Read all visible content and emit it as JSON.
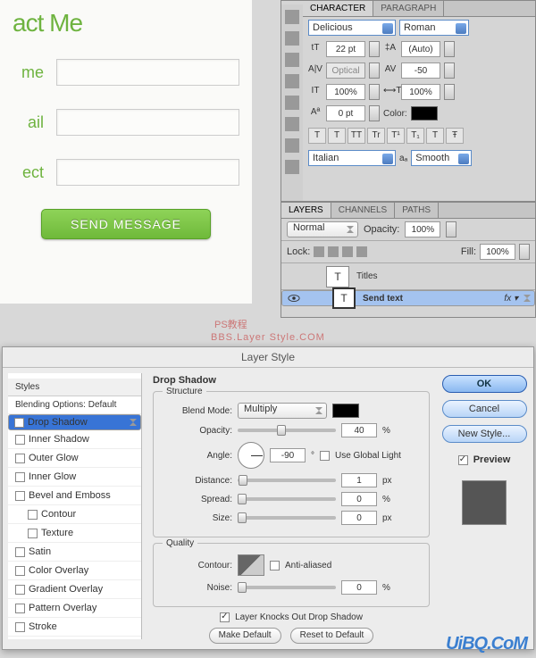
{
  "form": {
    "title": "act Me",
    "labels": {
      "name": "me",
      "email": "ail",
      "subject": "ect"
    },
    "button": "SEND MESSAGE"
  },
  "char_panel": {
    "tabs": [
      "CHARACTER",
      "PARAGRAPH"
    ],
    "font_family": "Delicious",
    "font_style": "Roman",
    "font_size": "22 pt",
    "leading": "(Auto)",
    "kerning": "Optical",
    "tracking": "-50",
    "scale_v": "100%",
    "scale_h": "100%",
    "baseline": "0 pt",
    "color_label": "Color:",
    "fmt": [
      "T",
      "T",
      "TT",
      "Tr",
      "T¹",
      "T₁",
      "T",
      "Ŧ"
    ],
    "language": "Italian",
    "aa_label": "aₐ",
    "aa_value": "Smooth"
  },
  "layers_panel": {
    "tabs": [
      "LAYERS",
      "CHANNELS",
      "PATHS"
    ],
    "blend": "Normal",
    "opacity_label": "Opacity:",
    "opacity": "100%",
    "lock_label": "Lock:",
    "fill_label": "Fill:",
    "fill": "100%",
    "layers": [
      {
        "name": "Titles",
        "sel": false
      },
      {
        "name": "Send text",
        "sel": true
      }
    ]
  },
  "watermark": {
    "l1": "PS教程",
    "l2": "BBS.Layer Style.COM"
  },
  "layer_style": {
    "title": "Layer Style",
    "side_header": "Styles",
    "blend_defaults": "Blending Options: Default",
    "effects": [
      {
        "name": "Drop Shadow",
        "checked": true,
        "sel": true
      },
      {
        "name": "Inner Shadow",
        "checked": false
      },
      {
        "name": "Outer Glow",
        "checked": false
      },
      {
        "name": "Inner Glow",
        "checked": false
      },
      {
        "name": "Bevel and Emboss",
        "checked": false
      },
      {
        "name": "Contour",
        "checked": false,
        "sub": true
      },
      {
        "name": "Texture",
        "checked": false,
        "sub": true
      },
      {
        "name": "Satin",
        "checked": false
      },
      {
        "name": "Color Overlay",
        "checked": false
      },
      {
        "name": "Gradient Overlay",
        "checked": false
      },
      {
        "name": "Pattern Overlay",
        "checked": false
      },
      {
        "name": "Stroke",
        "checked": false
      }
    ],
    "section": "Drop Shadow",
    "structure": "Structure",
    "blend_mode_label": "Blend Mode:",
    "blend_mode": "Multiply",
    "opacity_label": "Opacity:",
    "opacity": "40",
    "angle_label": "Angle:",
    "angle": "-90",
    "global_light": "Use Global Light",
    "distance_label": "Distance:",
    "distance": "1",
    "spread_label": "Spread:",
    "spread": "0",
    "size_label": "Size:",
    "size": "0",
    "px": "px",
    "deg": "°",
    "pct": "%",
    "quality": "Quality",
    "contour_label": "Contour:",
    "aa": "Anti-aliased",
    "noise_label": "Noise:",
    "noise": "0",
    "knockout": "Layer Knocks Out Drop Shadow",
    "make_default": "Make Default",
    "reset_default": "Reset to Default",
    "ok": "OK",
    "cancel": "Cancel",
    "new_style": "New Style...",
    "preview": "Preview"
  },
  "logo": "UiBQ.CoM"
}
